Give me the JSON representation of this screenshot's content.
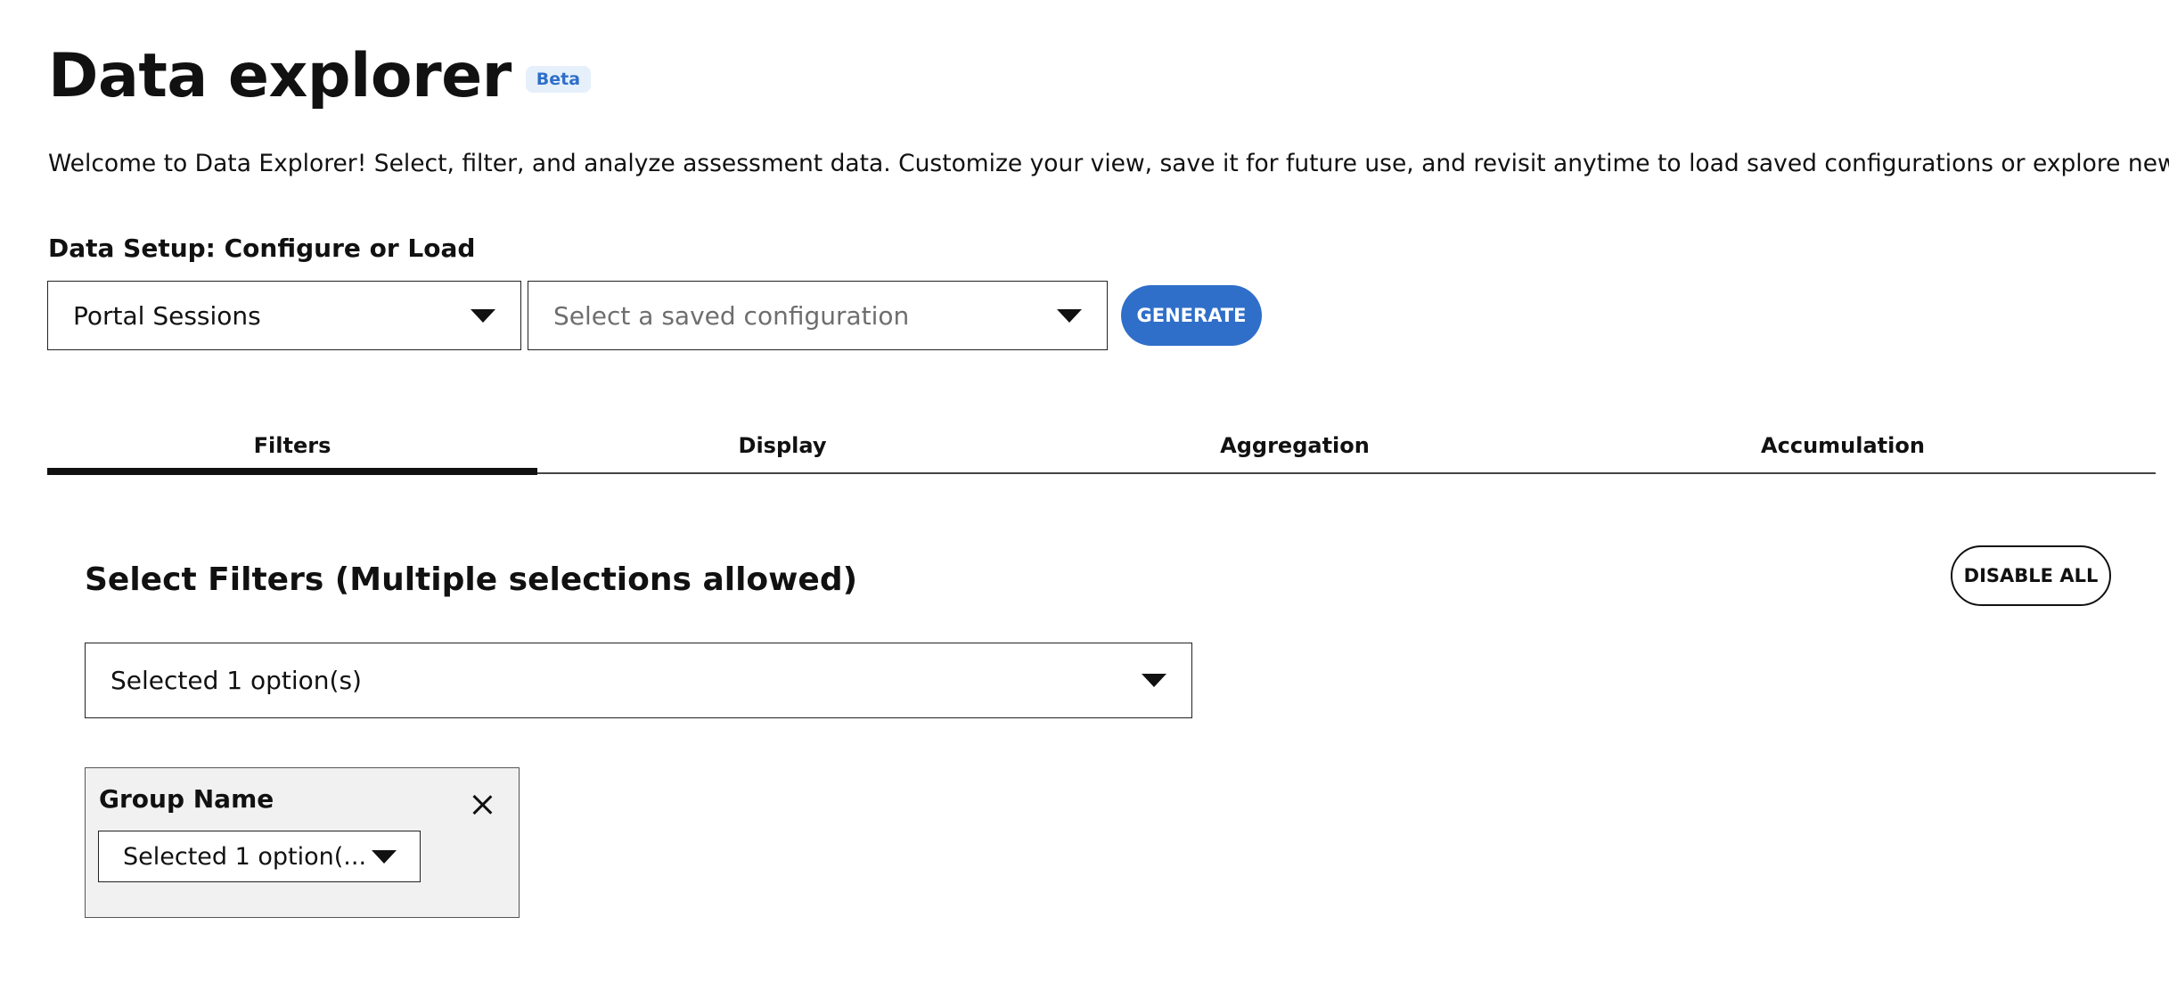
{
  "header": {
    "title": "Data explorer",
    "badge": "Beta",
    "intro": "Welcome to Data Explorer! Select, filter, and analyze assessment data. Customize your view, save it for future use, and revisit anytime to load saved configurations or explore new data."
  },
  "setup": {
    "label": "Data Setup: Configure or Load",
    "dataset_value": "Portal Sessions",
    "config_placeholder": "Select a saved configuration",
    "generate_label": "GENERATE"
  },
  "tabs": [
    {
      "label": "Filters",
      "active": true
    },
    {
      "label": "Display",
      "active": false
    },
    {
      "label": "Aggregation",
      "active": false
    },
    {
      "label": "Accumulation",
      "active": false
    }
  ],
  "filters": {
    "heading": "Select Filters (Multiple selections allowed)",
    "disable_all_label": "DISABLE ALL",
    "selector_value": "Selected 1 option(s)",
    "cards": [
      {
        "title": "Group Name",
        "value": "Selected 1 option(..."
      }
    ]
  },
  "colors": {
    "accent": "#2f6fc9",
    "badge_bg": "#e6f0fb",
    "card_bg": "#f1f1f1"
  },
  "icons": {
    "dropdown": "chevron-down-icon",
    "close": "close-icon"
  }
}
